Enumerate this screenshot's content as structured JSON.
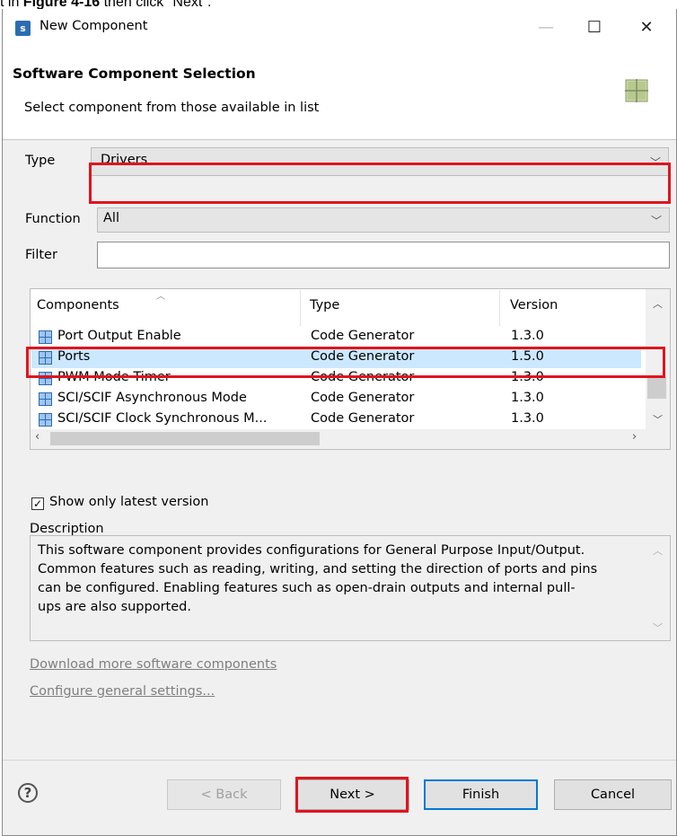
{
  "caption": {
    "prefix": "t in ",
    "figure_ref": "Figure 4-16",
    "suffix": " then click \"Next\"."
  },
  "window": {
    "title": "New Component",
    "minimize": "—",
    "maximize": "☐",
    "close": "✕"
  },
  "header": {
    "title": "Software Component Selection",
    "subtitle": "Select component from those available in list",
    "icon": "component-grid-icon"
  },
  "filters": {
    "type_label": "Type",
    "type_value": "Drivers",
    "function_label": "Function",
    "function_value": "All",
    "filter_label": "Filter",
    "filter_value": ""
  },
  "table": {
    "columns": [
      "Components",
      "Type",
      "Version"
    ],
    "rows": [
      {
        "name": "Port Output Enable",
        "type": "Code Generator",
        "version": "1.3.0"
      },
      {
        "name": "Ports",
        "type": "Code Generator",
        "version": "1.5.0",
        "selected": true
      },
      {
        "name": "PWM Mode Timer",
        "type": "Code Generator",
        "version": "1.3.0"
      },
      {
        "name": "SCI/SCIF Asynchronous Mode",
        "type": "Code Generator",
        "version": "1.3.0"
      },
      {
        "name": "SCI/SCIF Clock Synchronous M...",
        "type": "Code Generator",
        "version": "1.3.0"
      }
    ]
  },
  "show_latest": {
    "label": "Show only latest version",
    "checked": true
  },
  "description": {
    "label": "Description",
    "lines": [
      "This software component provides configurations for General Purpose Input/Output.",
      "Common features such as reading, writing, and setting the direction of ports and pins",
      "can be configured. Enabling features such as open-drain outputs and internal pull-",
      "ups are also supported."
    ]
  },
  "links": {
    "download": "Download more software components",
    "configure": "Configure general settings..."
  },
  "buttons": {
    "back": "< Back",
    "next": "Next >",
    "finish": "Finish",
    "cancel": "Cancel",
    "help": "?"
  },
  "colors": {
    "highlight": "#e0141e",
    "selection": "#cce8ff",
    "accent": "#0078d7"
  }
}
